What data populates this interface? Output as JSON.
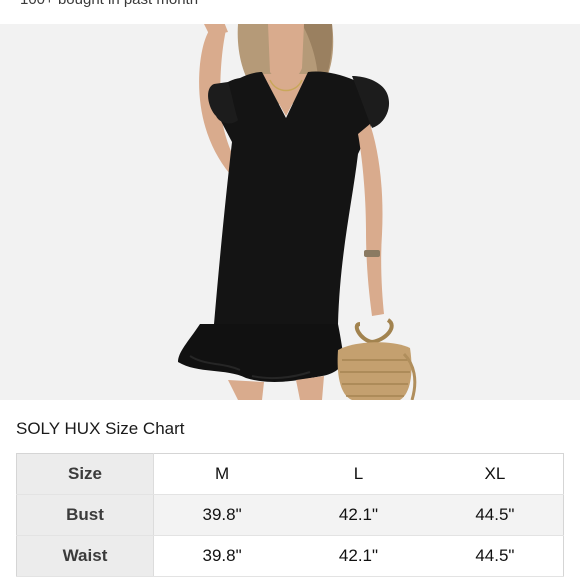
{
  "top_bar": {
    "purchase_note": "100+ bought in past month"
  },
  "product_image": {
    "subject": "black-ruffle-sleeve-mini-dress",
    "colors": {
      "background": "#f2f2f2",
      "dress": "#141414",
      "skin": "#d9ab8d",
      "hair": "#b59a78",
      "bag": "#c4a06f"
    }
  },
  "size_chart": {
    "title": "SOLY HUX Size Chart",
    "columns": [
      "Size",
      "M",
      "L",
      "XL"
    ],
    "rows": [
      {
        "label": "Bust",
        "values": [
          "39.8\"",
          "42.1\"",
          "44.5\""
        ]
      },
      {
        "label": "Waist",
        "values": [
          "39.8\"",
          "42.1\"",
          "44.5\""
        ]
      }
    ]
  }
}
